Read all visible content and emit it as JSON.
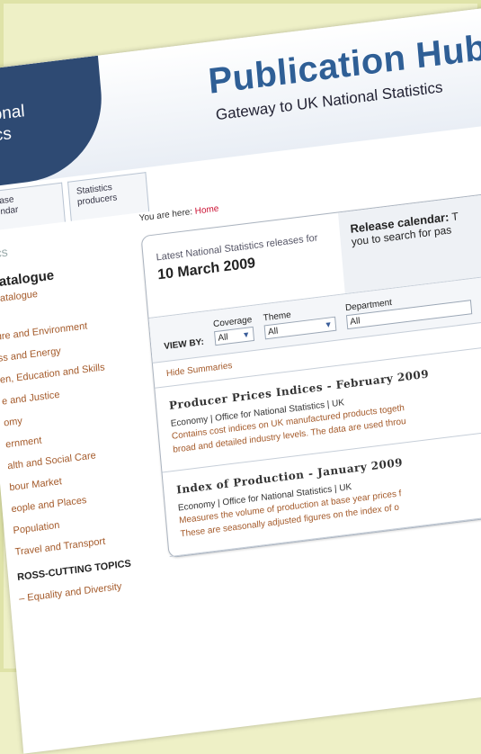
{
  "header": {
    "logo_line1": "tional",
    "logo_line2": "tics",
    "title": "Publication Hub",
    "subtitle": "Gateway to UK National Statistics"
  },
  "tabs": [
    {
      "line1": "lease",
      "line2": "lendar"
    },
    {
      "line1": "Statistics",
      "line2": "producers"
    }
  ],
  "sidebar": {
    "search_text": "tics",
    "catalogue_heading": "catalogue",
    "catalogue_link": "Catalogue",
    "items": [
      "ure and Environment",
      "ss and Energy",
      "en, Education and Skills",
      "e and Justice",
      "omy",
      "ernment",
      "alth and Social Care",
      "bour Market",
      "eople and Places",
      "Population",
      "Travel and Transport"
    ],
    "cross_heading": "ROSS-CUTTING TOPICS",
    "cross_items": [
      "– Equality and Diversity"
    ]
  },
  "main": {
    "breadcrumb_prefix": "You are here:",
    "breadcrumb_link": "Home",
    "latest_label": "Latest National Statistics releases for",
    "latest_date": "10 March 2009",
    "calendar_title": "Release calendar:",
    "calendar_text_1": "T",
    "calendar_text_2": "you to search for pas",
    "viewby_label": "VIEW BY:",
    "filters": [
      {
        "label": "Coverage",
        "value": "All"
      },
      {
        "label": "Theme",
        "value": "All"
      },
      {
        "label": "Department",
        "value": "All"
      }
    ],
    "hide_summaries": "Hide Summaries",
    "publications": [
      {
        "title": "Producer Prices Indices - February 2009",
        "meta": "Economy | Office for National Statistics | UK",
        "desc1": "Contains cost indices on UK manufactured products togeth",
        "desc2": "broad and detailed industry levels. The data are used throu"
      },
      {
        "title": "Index of Production - January 2009",
        "meta": "Economy | Office for National Statistics | UK",
        "desc1": "Measures the volume of production at base year prices f",
        "desc2": "These are seasonally adjusted figures on the index of o"
      }
    ]
  }
}
